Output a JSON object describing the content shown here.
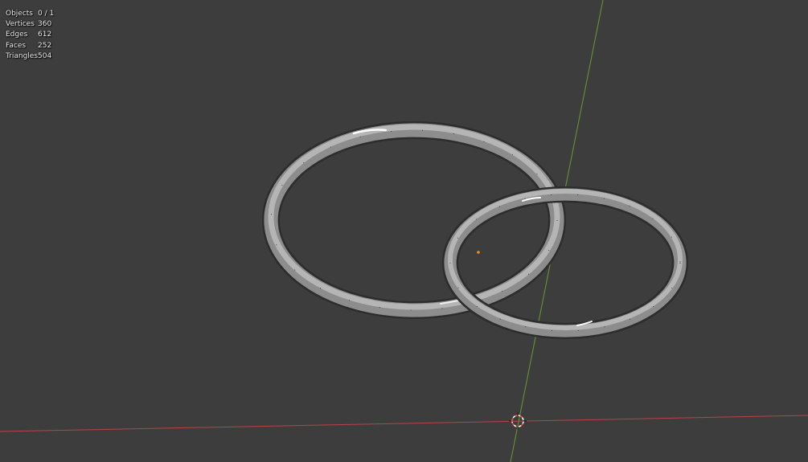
{
  "stats": {
    "rows": [
      {
        "label": "Objects",
        "value": "0 / 1"
      },
      {
        "label": "Vertices",
        "value": "360"
      },
      {
        "label": "Edges",
        "value": "612"
      },
      {
        "label": "Faces",
        "value": "252"
      },
      {
        "label": "Triangles",
        "value": "504"
      }
    ]
  },
  "colors": {
    "background": "#3d3d3d",
    "x_axis": "#c0464c",
    "y_axis": "#6e9a30",
    "mesh_fill": "#8a8a8a",
    "mesh_edge": "#2e2e2e",
    "origin_dot": "#ff8a00",
    "cursor_red": "#ff4a4a"
  },
  "scene": {
    "objects": [
      "ring-large",
      "ring-small"
    ],
    "icons": [
      "3d-cursor-icon",
      "object-origin-icon"
    ]
  }
}
